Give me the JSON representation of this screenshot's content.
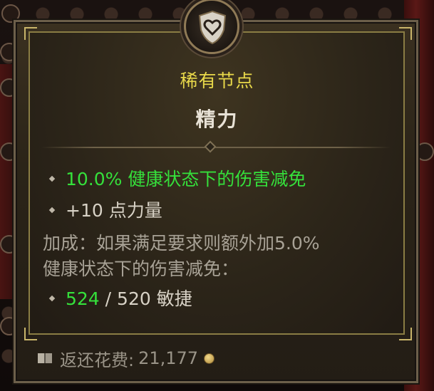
{
  "tooltip": {
    "rarity": "稀有节点",
    "name": "精力",
    "stats": [
      {
        "text": "10.0% 健康状态下的伤害减免",
        "color": "#35e03b"
      },
      {
        "text": "+10 点力量",
        "color": "#d8d2c6"
      }
    ],
    "bonus_line1": "加成：如果满足要求则额外加5.0%",
    "bonus_line2": "健康状态下的伤害减免：",
    "requirement": {
      "current": "524",
      "separator": " / 520 敏捷"
    },
    "footer": {
      "label": "返还花费:",
      "value": "21,177"
    }
  },
  "icons": [
    "shield-heart-emblem-icon",
    "book-icon",
    "coin-icon",
    "bullet-diamond-icon"
  ],
  "colors": {
    "rarity": "#e9d94a",
    "highlight": "#35e03b",
    "panel_border": "#8a7d44"
  }
}
